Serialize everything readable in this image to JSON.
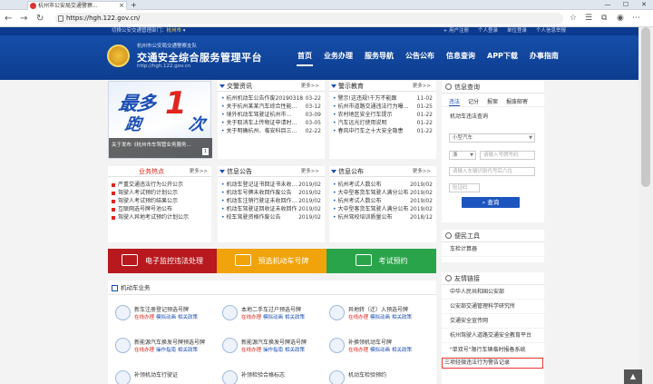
{
  "browser": {
    "tab_title": "杭州市公安局交通警察...",
    "new_tab": "+",
    "url": "https://hgh.122.gov.cn/",
    "window_controls": [
      "—",
      "☐",
      "✕"
    ]
  },
  "topstrip": {
    "switch_label": "切换公安交通管理部门：",
    "current_city": "杭州市",
    "links": [
      "+ 用户注册",
      "个人登录",
      "单位登录",
      "个人信息举报"
    ]
  },
  "header": {
    "sub": "杭州市公安局交通警察支队",
    "title": "交通安全综合服务管理平台",
    "url": "http://hgh.122.gov.cn"
  },
  "nav": [
    "首页",
    "业务办理",
    "服务导航",
    "公告公布",
    "信息查询",
    "APP下载",
    "办事指南"
  ],
  "banner": {
    "big1": "最多",
    "big2": "跑",
    "one": "1",
    "suffix": "次",
    "caption": "关于发布《杭州市车驾管业务服务...",
    "page": "1"
  },
  "news": {
    "title": "交警资讯",
    "more": "更多>>",
    "items": [
      {
        "text": "杭州机动车公告作废20190318",
        "date": "03-22"
      },
      {
        "text": "关于杭州某某汽车综合性能...",
        "date": "03-12"
      },
      {
        "text": "境外机动车驾驶证杭州市...",
        "date": "03-09"
      },
      {
        "text": "关于取消车上传物证申请时...",
        "date": "03-05"
      },
      {
        "text": "关于明确杭州、临安科目三...",
        "date": "02-22"
      }
    ]
  },
  "edu": {
    "title": "警示教育",
    "more": "更多>>",
    "items": [
      {
        "text": "警示!这违规!千万不能跟",
        "date": "11-02"
      },
      {
        "text": "杭州市道路交通违法行为曝...",
        "date": "01-25"
      },
      {
        "text": "农村地区安全行车提示",
        "date": "01-22"
      },
      {
        "text": "汽车远光灯使用说明",
        "date": "01-22"
      },
      {
        "text": "春风中行车之十大安全隐患",
        "date": "01-22"
      }
    ]
  },
  "hot": {
    "title": "业务热点",
    "more": "更多>>",
    "items": [
      "严重交通违法行为公开公示",
      "驾驶人考试预约计划公示",
      "驾驶人考试预约结果公示",
      "互联网选号牌号池公布",
      "驾驶人异地考试预约计划公示"
    ]
  },
  "notice": {
    "title": "信息公告",
    "more": "更多>>",
    "items": [
      {
        "text": "机动车登记证书回证书未收...",
        "date": "2019/02"
      },
      {
        "text": "机动车号牌未收回作废公告",
        "date": "2019/02"
      },
      {
        "text": "机动车注销行驶证未收回作...",
        "date": "2019/02"
      },
      {
        "text": "机动车驾驶证回收证未收回作...",
        "date": "2019/02"
      },
      {
        "text": "校车驾驶资格作废公告",
        "date": "2019/02"
      }
    ]
  },
  "publish": {
    "title": "信息公布",
    "more": "更多>>",
    "items": [
      {
        "text": "杭州考试人数公布",
        "date": "2019/02"
      },
      {
        "text": "大中型客货车驾驶人满分公布",
        "date": "2019/02"
      },
      {
        "text": "杭州考试人数公布",
        "date": "2019/02"
      },
      {
        "text": "大中型客货车驾驶人满分公布",
        "date": "2019/02"
      },
      {
        "text": "杭州驾校培训质量公布",
        "date": "2018/12"
      }
    ]
  },
  "strips": [
    {
      "label": "电子监控违法处理",
      "color": "#b7191e"
    },
    {
      "label": "预选机动车号牌",
      "color": "#f0a30a"
    },
    {
      "label": "考试预约",
      "color": "#2aa44a"
    }
  ],
  "biz": {
    "title": "机动车业务",
    "items": [
      {
        "name": "新车注册登记预选号牌",
        "s": [
          "在线办理",
          "模拟动画",
          "相关政策"
        ]
      },
      {
        "name": "本地二手车过户预选号牌",
        "s": [
          "在线办理",
          "模拟动画",
          "相关政策"
        ]
      },
      {
        "name": "异地转（迁）入预选号牌",
        "s": [
          "在线办理",
          "模拟动画",
          "相关政策"
        ]
      },
      {
        "name": "新能源汽车换发号牌预选号牌",
        "s": [
          "在线办理",
          "操作指南",
          "相关政策"
        ]
      },
      {
        "name": "新能源汽车换发号牌选号牌",
        "s": [
          "在线办理",
          "操作指南",
          "相关政策"
        ]
      },
      {
        "name": "补换领机动车号牌",
        "s": [
          "在线办理",
          "模拟动画",
          "相关政策"
        ]
      },
      {
        "name": "补领机动车行驶证",
        "s": []
      },
      {
        "name": "补领检验合格标志",
        "s": []
      },
      {
        "name": "机动车检验预约",
        "s": []
      }
    ]
  },
  "query": {
    "title": "信息查询",
    "tabs": [
      "违法",
      "记分",
      "报案",
      "报废邮寄"
    ],
    "label": "机动车违法查询",
    "type": "小型汽车",
    "prov": "浙",
    "plate_ph": "请输入号牌号码",
    "vin_ph": "请输入车辆识别代号后六位",
    "code_ph": "验证码",
    "btn": "查询"
  },
  "tools": {
    "title": "便民工具",
    "items": [
      "车检计算器"
    ]
  },
  "links": {
    "title": "友情链接",
    "items": [
      "中华人民共和国公安部",
      "公安部交通管理科学研究所",
      "交通安全宣传网",
      "杭州驾驶人道路交通安全教育平台",
      "\"单双号\"限行车辆临时报备系统",
      "三项轻微违法行为警告记录"
    ]
  },
  "totop": "▲"
}
